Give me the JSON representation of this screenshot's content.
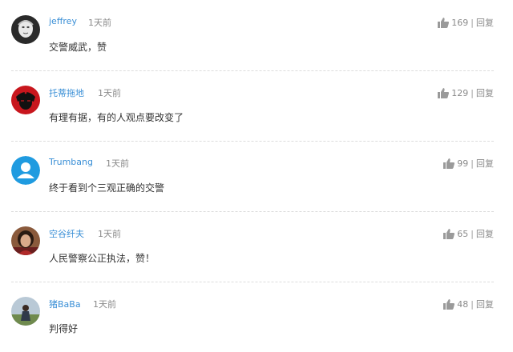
{
  "comments": [
    {
      "user": "jeffrey",
      "time": "1天前",
      "text": "交警威武，赞",
      "likes": "169",
      "reply": "回复",
      "avatar": "avatar-sketch"
    },
    {
      "user": "托蒂拖地",
      "time": "1天前",
      "text": "有理有据，有的人观点要改变了",
      "likes": "129",
      "reply": "回复",
      "avatar": "avatar-portrait-red"
    },
    {
      "user": "Trumbang",
      "time": "1天前",
      "text": "终于看到个三观正确的交警",
      "likes": "99",
      "reply": "回复",
      "avatar": "avatar-default-user"
    },
    {
      "user": "空谷纤夫",
      "time": "1天前",
      "text": "人民警察公正执法，赞！",
      "likes": "65",
      "reply": "回复",
      "avatar": "avatar-photo-woman"
    },
    {
      "user": "猪BaBa",
      "time": "1天前",
      "text": "判得好",
      "likes": "48",
      "reply": "回复",
      "avatar": "avatar-photo-landscape"
    }
  ],
  "separator": "|",
  "colors": {
    "username": "#3a8fd6",
    "meta": "#8a8a8a",
    "text": "#333333",
    "divider": "#dcdcdc",
    "default_avatar": "#1f9be0"
  }
}
